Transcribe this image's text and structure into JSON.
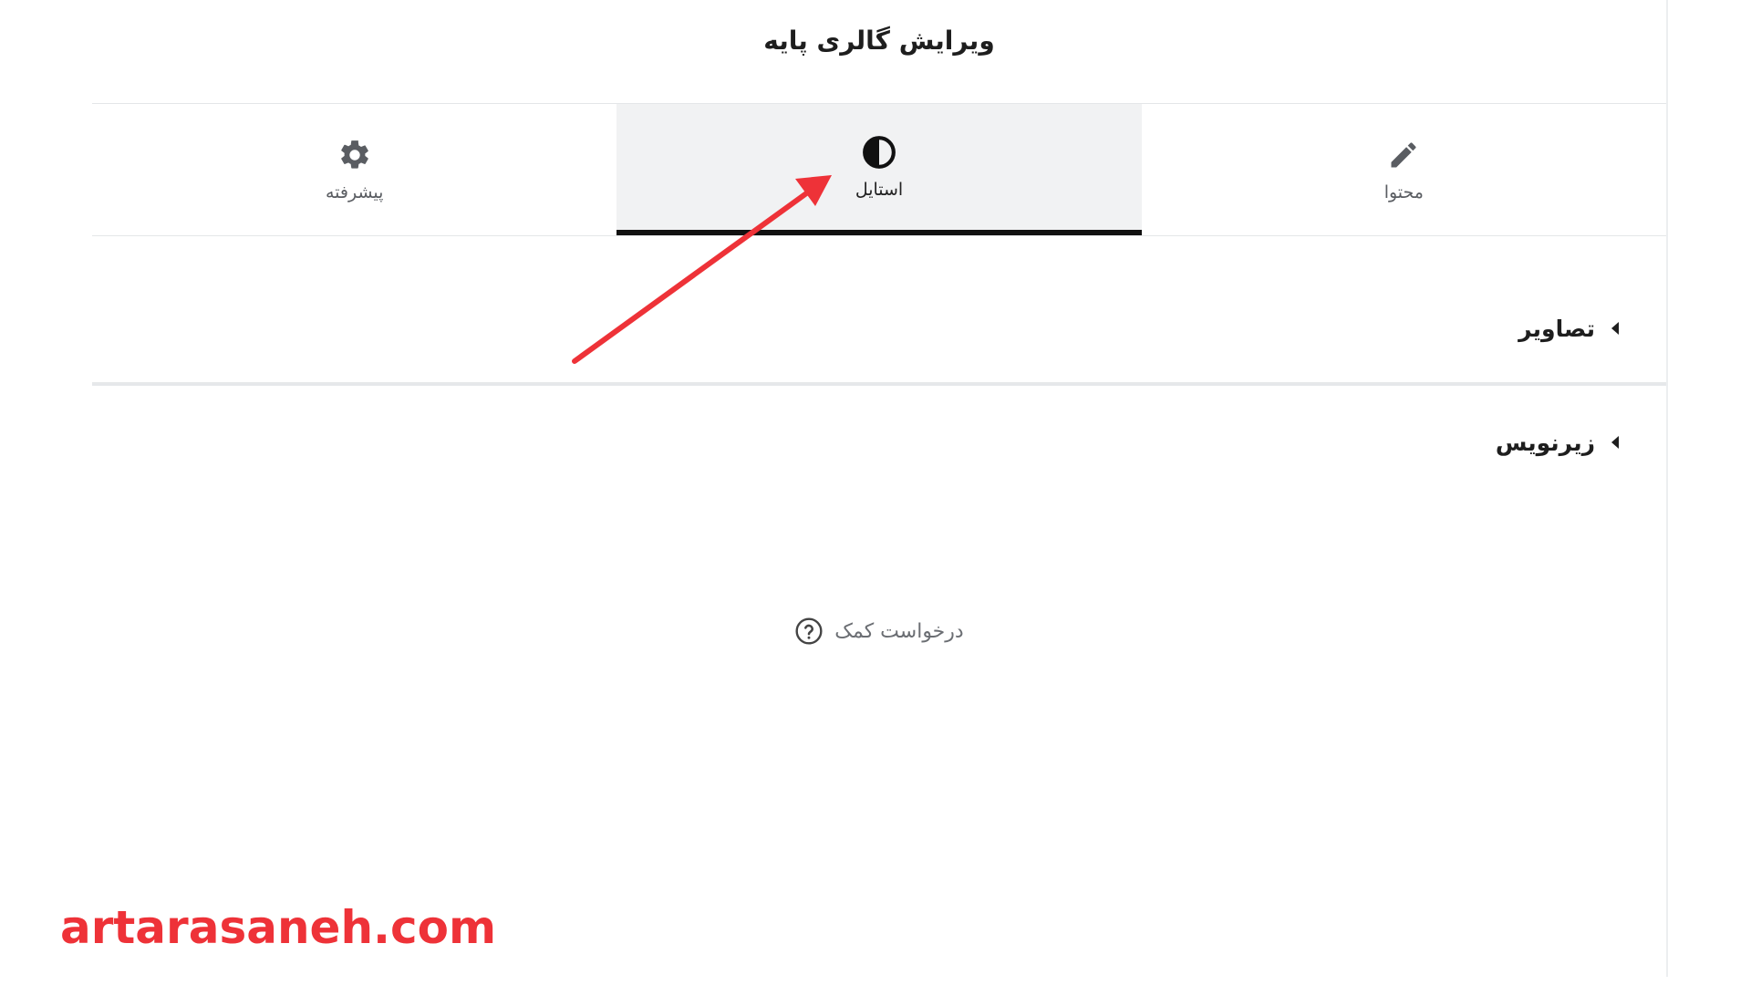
{
  "panel": {
    "title": "ویرایش گالری پایه"
  },
  "tabs": [
    {
      "label": "محتوا",
      "icon": "pencil-icon",
      "active": false
    },
    {
      "label": "استایل",
      "icon": "half-circle-contrast-icon",
      "active": true
    },
    {
      "label": "پیشرفته",
      "icon": "gear-icon",
      "active": false
    }
  ],
  "sections": [
    {
      "label": "تصاویر",
      "icon": "caret-left-icon"
    },
    {
      "label": "زیرنویس",
      "icon": "caret-left-icon"
    }
  ],
  "help": {
    "label": "درخواست کمک",
    "icon": "question-circle-icon"
  },
  "watermark": {
    "text": "artarasaneh.com",
    "color": "#ee3238"
  },
  "annotation": {
    "type": "arrow",
    "color": "#ee3238",
    "target": "tab-style"
  },
  "colors": {
    "active_tab_bg": "#f1f2f3",
    "active_tab_indicator": "#111111",
    "text_primary": "#1e1e1e",
    "text_muted": "#5a5d62"
  }
}
